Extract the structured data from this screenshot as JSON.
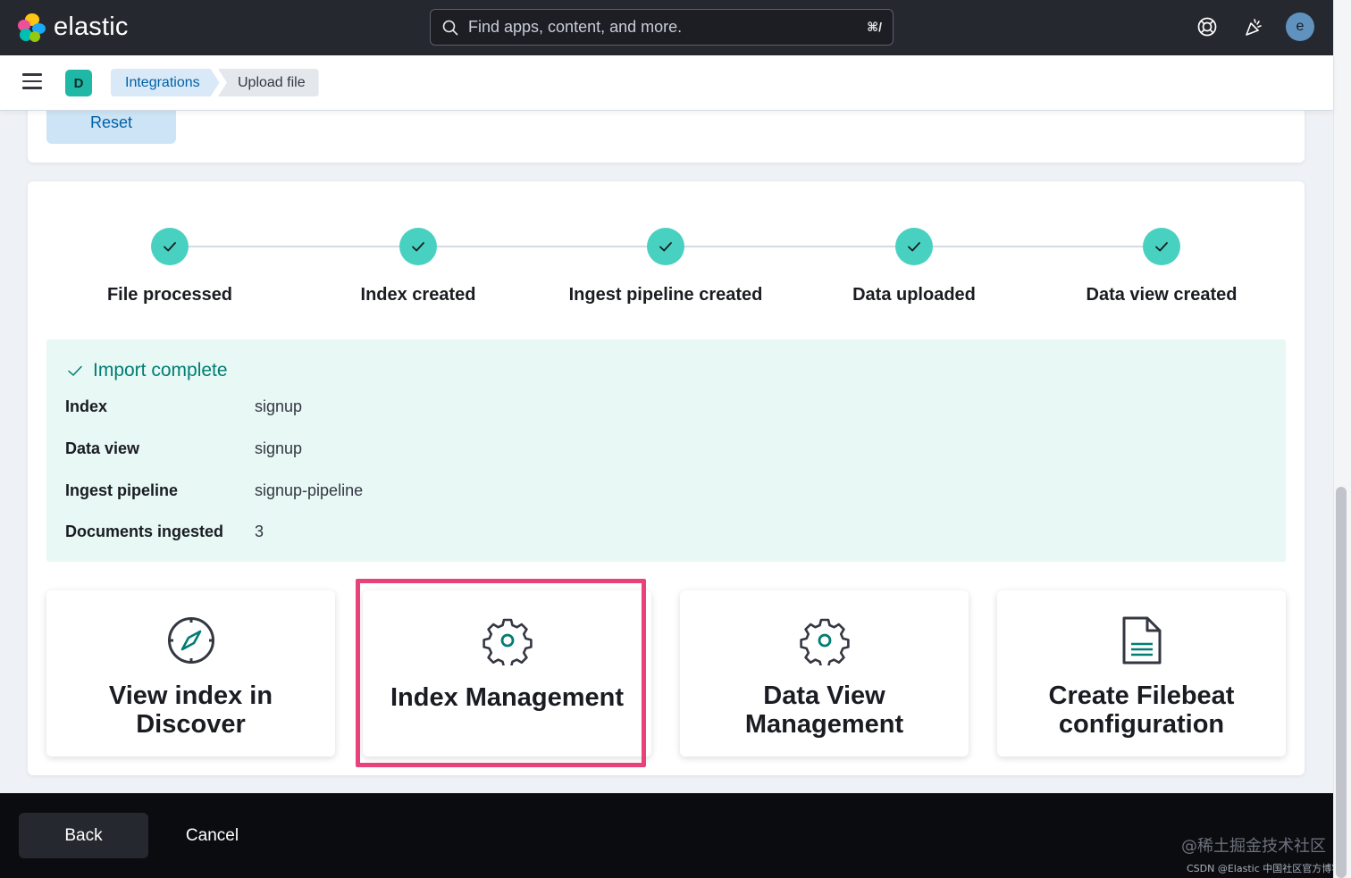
{
  "header": {
    "brand": "elastic",
    "search_placeholder": "Find apps, content, and more.",
    "search_shortcut": "⌘/",
    "avatar_initial": "e"
  },
  "breadcrumb": {
    "space_initial": "D",
    "items": [
      {
        "label": "Integrations"
      },
      {
        "label": "Upload file"
      }
    ]
  },
  "top_card": {
    "reset_label": "Reset"
  },
  "steps": [
    {
      "label": "File processed",
      "status": "complete"
    },
    {
      "label": "Index created",
      "status": "complete"
    },
    {
      "label": "Ingest pipeline created",
      "status": "complete"
    },
    {
      "label": "Data uploaded",
      "status": "complete"
    },
    {
      "label": "Data view created",
      "status": "complete"
    }
  ],
  "import_result": {
    "title": "Import complete",
    "rows": [
      {
        "key": "Index",
        "value": "signup"
      },
      {
        "key": "Data view",
        "value": "signup"
      },
      {
        "key": "Ingest pipeline",
        "value": "signup-pipeline"
      },
      {
        "key": "Documents ingested",
        "value": "3"
      }
    ]
  },
  "actions": [
    {
      "label": "View index in Discover",
      "icon": "compass-icon"
    },
    {
      "label": "Index Management",
      "icon": "gear-icon",
      "highlighted": true
    },
    {
      "label": "Data View Management",
      "icon": "gear-icon"
    },
    {
      "label": "Create Filebeat configuration",
      "icon": "document-icon"
    }
  ],
  "footer": {
    "back_label": "Back",
    "cancel_label": "Cancel"
  },
  "watermark": {
    "line1": "@稀土掘金技术社区",
    "line2": "CSDN @Elastic 中国社区官方博客"
  },
  "colors": {
    "header_bg": "#25282f",
    "step_complete": "#48d1c0",
    "callout_bg": "#e7f8f5",
    "callout_title": "#017d73",
    "highlight_border": "#e8427c",
    "link_blue": "#0061a6"
  }
}
